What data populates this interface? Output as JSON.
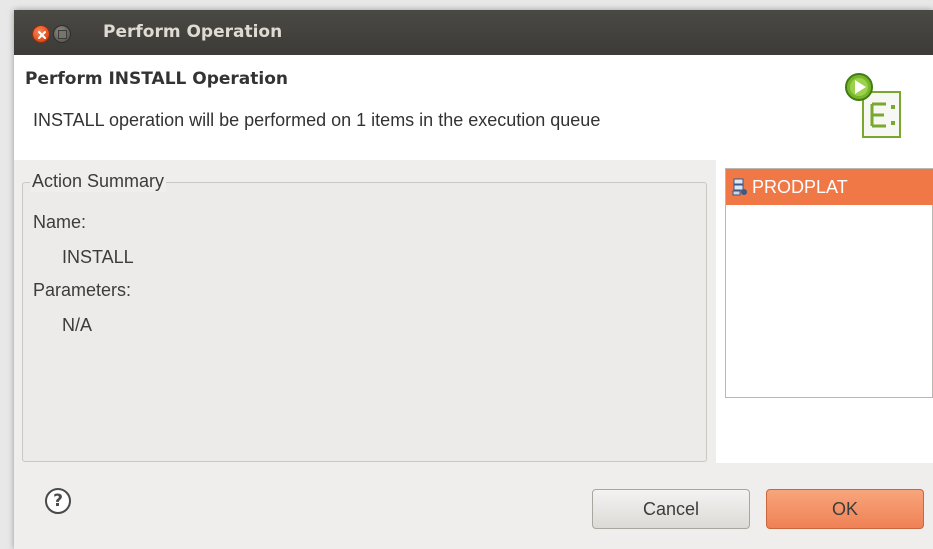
{
  "window": {
    "title": "Perform Operation"
  },
  "header": {
    "title": "Perform INSTALL Operation",
    "description": "INSTALL operation will be performed on 1 items in the execution queue",
    "icon": "execute-queue-icon"
  },
  "summary": {
    "legend": "Action Summary",
    "name_label": "Name:",
    "name_value": "INSTALL",
    "parameters_label": "Parameters:",
    "parameters_value": "N/A"
  },
  "queue": {
    "items": [
      {
        "label": "PRODPLAT",
        "icon": "server-node-icon",
        "selected": true
      }
    ]
  },
  "footer": {
    "help_symbol": "?",
    "cancel_label": "Cancel",
    "ok_label": "OK"
  },
  "colors": {
    "accent": "#f07746",
    "titlebar": "#3c3b37"
  }
}
